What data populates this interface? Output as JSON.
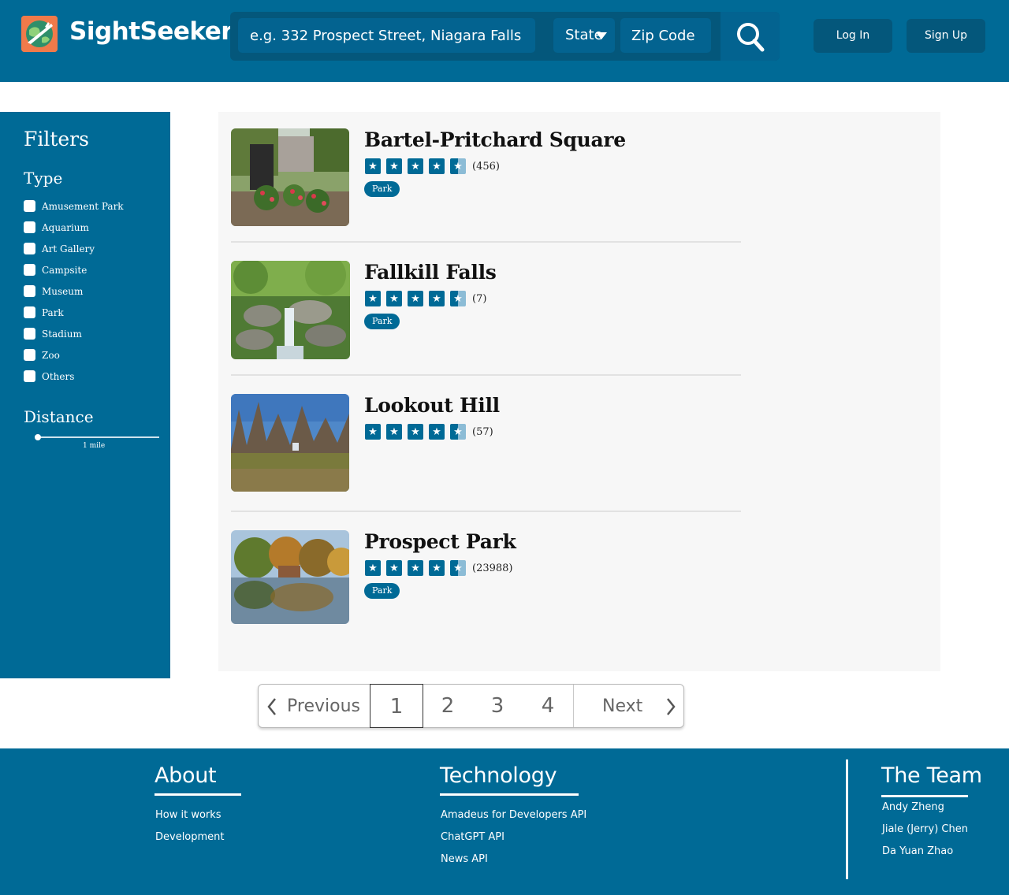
{
  "brand": {
    "name": "SightSeeker",
    "icon": "globe-airplane-icon"
  },
  "search": {
    "placeholder": "e.g. 332 Prospect Street, Niagara Falls",
    "state_label": "State",
    "zip_placeholder": "Zip Code"
  },
  "auth": {
    "login": "Log In",
    "signup": "Sign Up"
  },
  "filters": {
    "title": "Filters",
    "type_heading": "Type",
    "types": [
      "Amusement Park",
      "Aquarium",
      "Art Gallery",
      "Campsite",
      "Museum",
      "Park",
      "Stadium",
      "Zoo",
      "Others"
    ],
    "distance_heading": "Distance",
    "distance_value": "1 mile",
    "distance_fraction": 0.0
  },
  "results": [
    {
      "name": "Bartel-Pritchard Square",
      "rating_stars": 4.5,
      "review_count": "(456)",
      "tag": "Park"
    },
    {
      "name": "Fallkill Falls",
      "rating_stars": 4.5,
      "review_count": "(7)",
      "tag": "Park"
    },
    {
      "name": "Lookout Hill",
      "rating_stars": 4.5,
      "review_count": "(57)",
      "tag": ""
    },
    {
      "name": "Prospect Park",
      "rating_stars": 4.5,
      "review_count": "(23988)",
      "tag": "Park"
    }
  ],
  "pagination": {
    "previous": "Previous",
    "next": "Next",
    "pages": [
      "1",
      "2",
      "3",
      "4"
    ],
    "current": "1"
  },
  "footer": {
    "about": {
      "heading": "About",
      "links": [
        "How it works",
        "Development"
      ]
    },
    "technology": {
      "heading": "Technology",
      "links": [
        "Amadeus for Developers API",
        "ChatGPT API",
        "News API"
      ]
    },
    "team": {
      "heading": "The Team",
      "members": [
        "Andy Zheng",
        "Jiale (Jerry) Chen",
        "Da Yuan Zhao"
      ]
    }
  },
  "colors": {
    "primary": "#006a96",
    "dark": "#04577b",
    "panel": "#f7f7f7"
  }
}
